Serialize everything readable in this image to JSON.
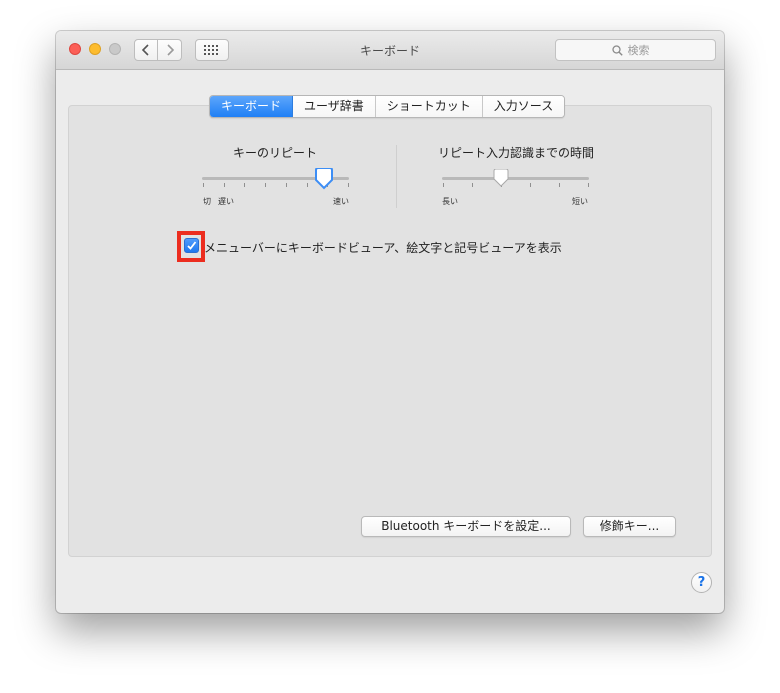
{
  "window": {
    "title": "キーボード"
  },
  "toolbar": {
    "search_placeholder": "検索"
  },
  "tabs": [
    {
      "label": "キーボード",
      "active": true
    },
    {
      "label": "ユーザ辞書",
      "active": false
    },
    {
      "label": "ショートカット",
      "active": false
    },
    {
      "label": "入力ソース",
      "active": false
    }
  ],
  "key_repeat": {
    "title": "キーのリピート",
    "labels": {
      "off": "切",
      "slow": "遅い",
      "fast": "速い"
    },
    "ticks": 8,
    "value_fraction": 0.83
  },
  "repeat_delay": {
    "title": "リピート入力認識までの時間",
    "labels": {
      "long": "長い",
      "short": "短い"
    },
    "ticks": 6,
    "value_fraction": 0.4
  },
  "show_viewer": {
    "label": "メニューバーにキーボードビューア、絵文字と記号ビューアを表示",
    "checked": true
  },
  "buttons": {
    "bluetooth": "Bluetooth キーボードを設定...",
    "modifier": "修飾キー...",
    "help": "?"
  },
  "colors": {
    "accent": "#1f7ff5",
    "highlight": "#ec2d1f"
  }
}
